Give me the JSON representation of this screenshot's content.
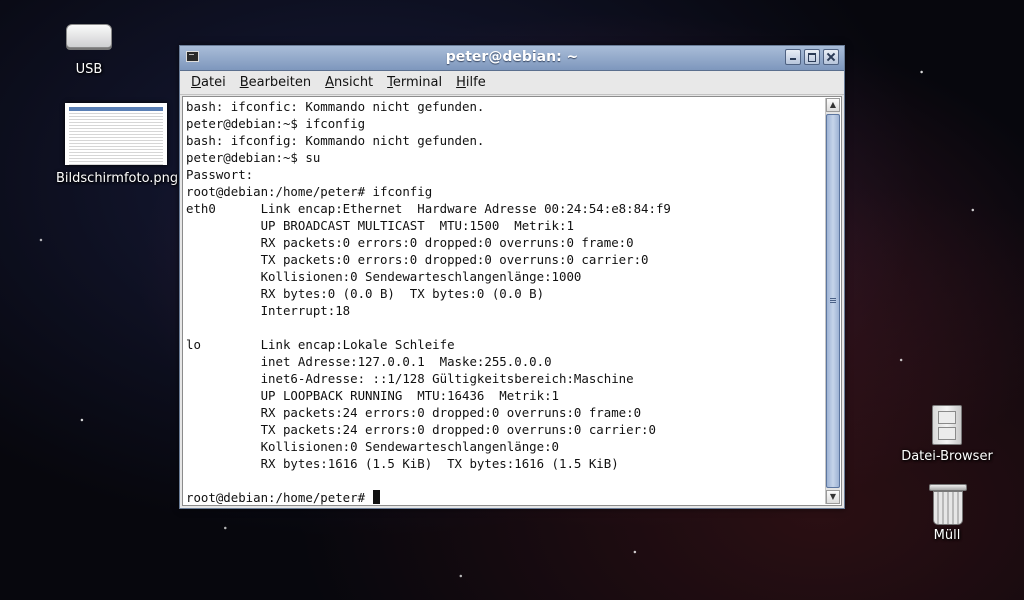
{
  "desktop": {
    "icons": [
      {
        "label": "USB"
      },
      {
        "label": "Bildschirmfoto.png"
      },
      {
        "label": "Datei-Browser"
      },
      {
        "label": "Müll"
      }
    ]
  },
  "window": {
    "title": "peter@debian: ~",
    "menu": [
      "Datei",
      "Bearbeiten",
      "Ansicht",
      "Terminal",
      "Hilfe"
    ],
    "menu_mnemonics": [
      "D",
      "B",
      "A",
      "T",
      "H"
    ]
  },
  "terminal": {
    "lines": [
      "bash: ifconfic: Kommando nicht gefunden.",
      "peter@debian:~$ ifconfig",
      "bash: ifconfig: Kommando nicht gefunden.",
      "peter@debian:~$ su",
      "Passwort:",
      "root@debian:/home/peter# ifconfig",
      "eth0      Link encap:Ethernet  Hardware Adresse 00:24:54:e8:84:f9",
      "          UP BROADCAST MULTICAST  MTU:1500  Metrik:1",
      "          RX packets:0 errors:0 dropped:0 overruns:0 frame:0",
      "          TX packets:0 errors:0 dropped:0 overruns:0 carrier:0",
      "          Kollisionen:0 Sendewarteschlangenlänge:1000",
      "          RX bytes:0 (0.0 B)  TX bytes:0 (0.0 B)",
      "          Interrupt:18",
      "",
      "lo        Link encap:Lokale Schleife",
      "          inet Adresse:127.0.0.1  Maske:255.0.0.0",
      "          inet6-Adresse: ::1/128 Gültigkeitsbereich:Maschine",
      "          UP LOOPBACK RUNNING  MTU:16436  Metrik:1",
      "          RX packets:24 errors:0 dropped:0 overruns:0 frame:0",
      "          TX packets:24 errors:0 dropped:0 overruns:0 carrier:0",
      "          Kollisionen:0 Sendewarteschlangenlänge:0",
      "          RX bytes:1616 (1.5 KiB)  TX bytes:1616 (1.5 KiB)",
      ""
    ],
    "prompt": "root@debian:/home/peter# "
  },
  "colors": {
    "titlebar": "#7e97bd",
    "terminal_bg": "#ffffff",
    "terminal_fg": "#111111"
  }
}
